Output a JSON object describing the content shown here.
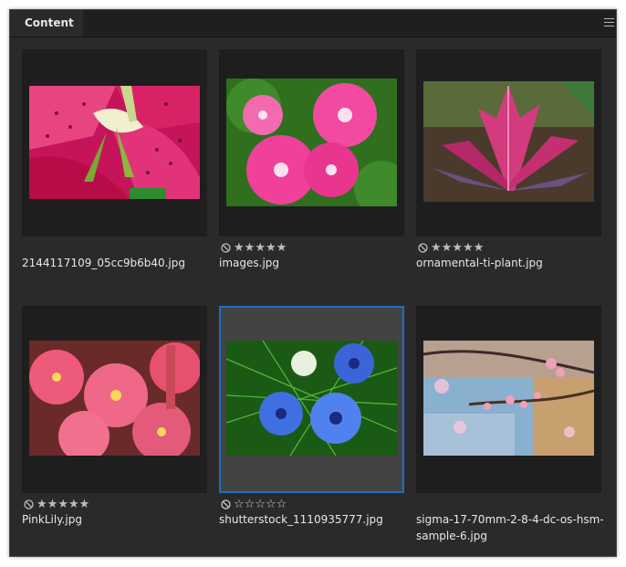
{
  "panel": {
    "tab_label": "Content",
    "menu_icon": "menu-icon"
  },
  "items": [
    {
      "filename": "2144117109_05cc9b6b40.jpg",
      "rating": null,
      "selected": false
    },
    {
      "filename": "images.jpg",
      "rating": 5,
      "selected": false
    },
    {
      "filename": "ornamental-ti-plant.jpg",
      "rating": 5,
      "selected": false
    },
    {
      "filename": "PinkLily.jpg",
      "rating": 5,
      "selected": false
    },
    {
      "filename": "shutterstock_1110935777.jpg",
      "rating": 0,
      "selected": true
    },
    {
      "filename": "sigma-17-70mm-2-8-4-dc-os-hsm-sample-6.jpg",
      "rating": null,
      "selected": false
    }
  ]
}
